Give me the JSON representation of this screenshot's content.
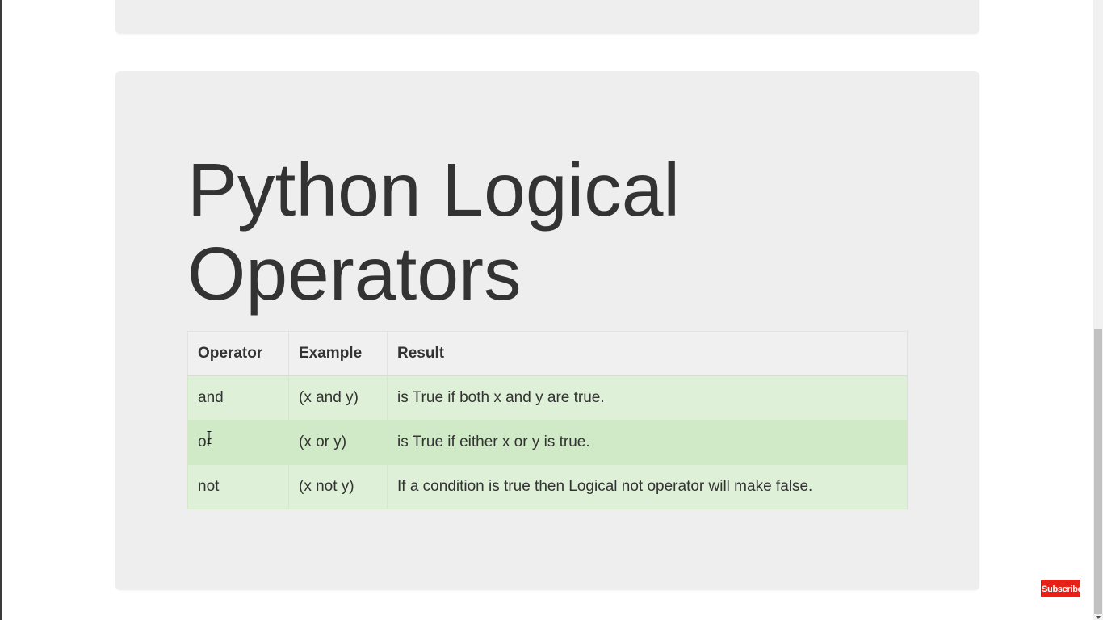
{
  "page": {
    "title": "Python Logical Operators"
  },
  "operators_table": {
    "headers": [
      "Operator",
      "Example",
      "Result"
    ],
    "rows": [
      {
        "operator": "and",
        "example": "(x and y)",
        "result": "is True if both x and y are true."
      },
      {
        "operator": "or",
        "example": "(x or y)",
        "result": "is True if either x or y is true."
      },
      {
        "operator": "not",
        "example": "(x not y)",
        "result": "If a condition is true then Logical not operator will make false."
      }
    ]
  },
  "overlay": {
    "subscribe_label": "Subscribe"
  },
  "colors": {
    "panel_bg": "#eeeeee",
    "row_success_bg": "#dff0d8",
    "row_hover_bg": "#d0e9c6",
    "subscribe_bg": "#e62117"
  }
}
